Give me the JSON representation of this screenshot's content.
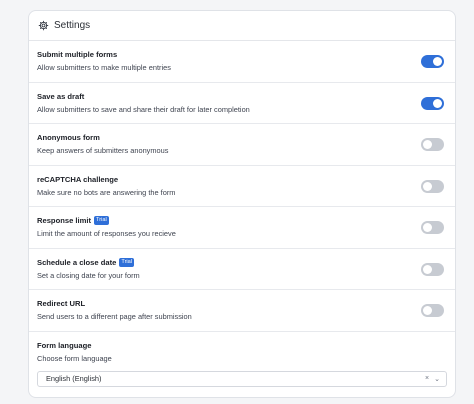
{
  "header": {
    "title": "Settings",
    "icon": "gear-icon"
  },
  "settings": [
    {
      "title": "Submit multiple forms",
      "description": "Allow submitters to make multiple entries",
      "enabled": true,
      "badge": ""
    },
    {
      "title": "Save as draft",
      "description": "Allow submitters to save and share their draft for later completion",
      "enabled": true,
      "badge": ""
    },
    {
      "title": "Anonymous form",
      "description": "Keep answers of submitters anonymous",
      "enabled": false,
      "badge": ""
    },
    {
      "title": "reCAPTCHA challenge",
      "description": "Make sure no bots are answering the form",
      "enabled": false,
      "badge": ""
    },
    {
      "title": "Response limit",
      "description": "Limit the amount of responses you recieve",
      "enabled": false,
      "badge": "Trial"
    },
    {
      "title": "Schedule a close date",
      "description": "Set a closing date for your form",
      "enabled": false,
      "badge": "Trial"
    },
    {
      "title": "Redirect URL",
      "description": "Send users to a different page after submission",
      "enabled": false,
      "badge": ""
    }
  ],
  "language": {
    "title": "Form language",
    "description": "Choose form language",
    "selected": "English (English)",
    "clear_icon": "×",
    "chevron_icon": "⌄"
  },
  "colors": {
    "accent": "#2f6fd8",
    "toggle_off": "#c7cbd2"
  }
}
